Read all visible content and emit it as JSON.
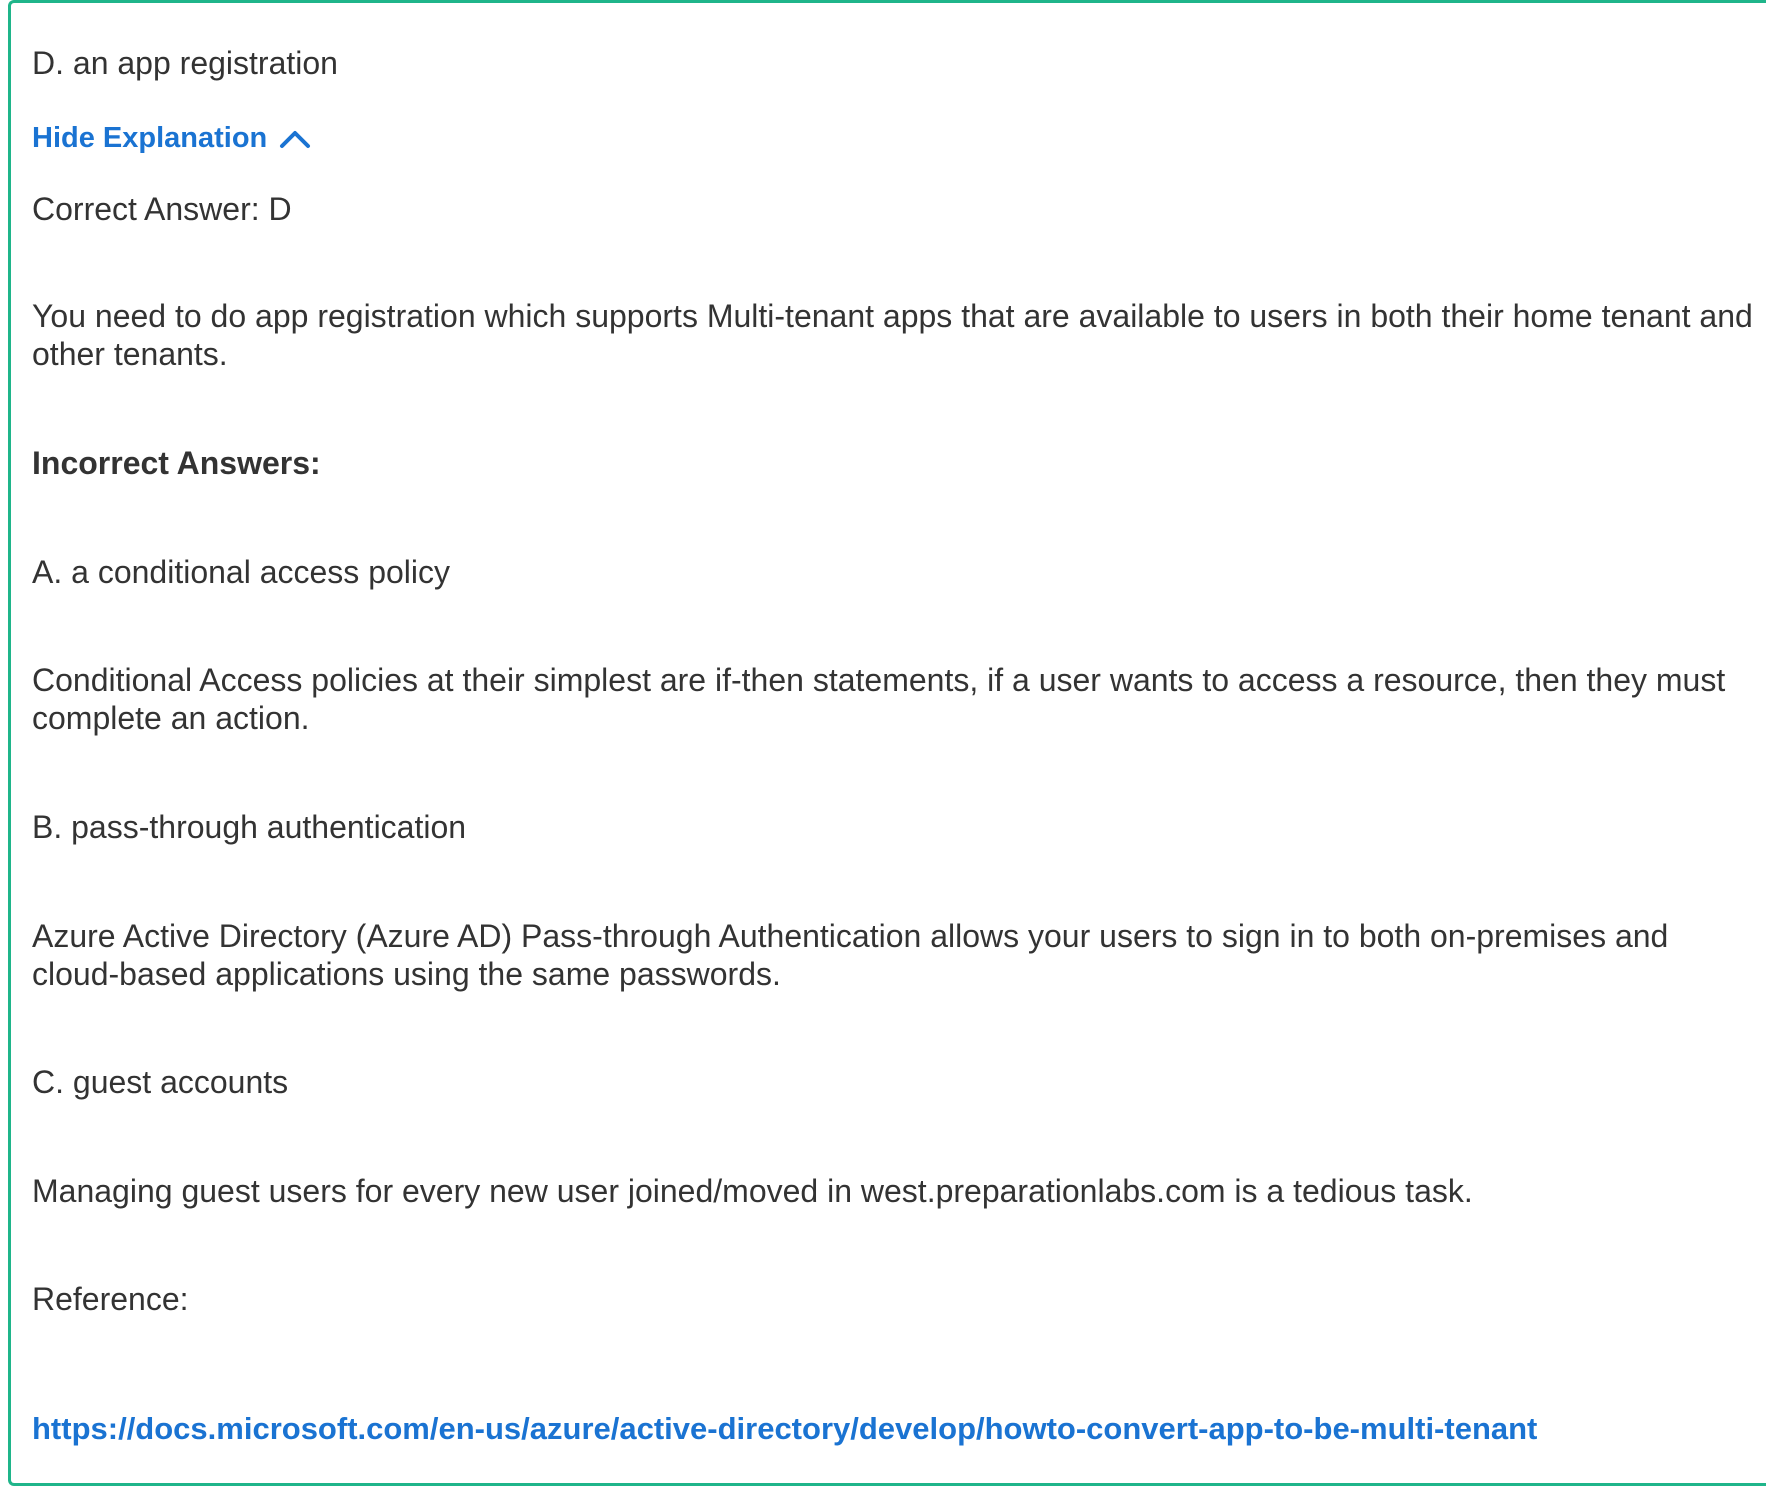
{
  "option_d": "D. an app registration",
  "toggle_label": "Hide Explanation",
  "correct_answer": "Correct Answer: D",
  "explanation": "You need to do app registration which supports Multi-tenant apps that are available to users in both their home tenant and other tenants.",
  "incorrect_heading": "Incorrect Answers:",
  "incorrect": [
    {
      "option": "A. a conditional access policy",
      "reason": "Conditional Access policies at their simplest are if-then statements, if a user wants to access a resource, then they must complete an action."
    },
    {
      "option": "B. pass-through authentication",
      "reason": "Azure Active Directory (Azure AD) Pass-through Authentication allows your users to sign in to both on-premises and cloud-based applications using the same passwords."
    },
    {
      "option": "C. guest accounts",
      "reason": "Managing guest users for every new user joined/moved in west.preparationlabs.com is a tedious task."
    }
  ],
  "reference_label": "Reference:",
  "reference_url": "https://docs.microsoft.com/en-us/azure/active-directory/develop/howto-convert-app-to-be-multi-tenant",
  "colors": {
    "border": "#1fb58a",
    "link": "#1a73d2",
    "text": "#333333"
  },
  "icons": {
    "toggle": "chevron-up-icon"
  }
}
